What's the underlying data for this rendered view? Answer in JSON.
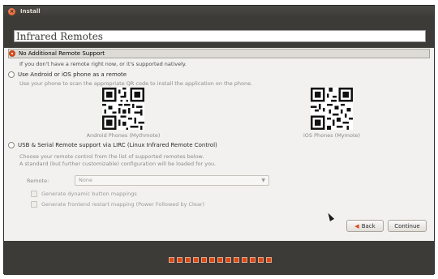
{
  "window": {
    "title": "Install"
  },
  "header": {
    "title": "Infrared Remotes"
  },
  "options": [
    {
      "label": "No Additional Remote Support",
      "description": "If you don't have a remote right now, or it's supported natively.",
      "selected": true
    },
    {
      "label": "Use Android or iOS phone as a remote",
      "description": "Use your phone to scan the appropriate QR code to install the application on the phone.",
      "selected": false
    },
    {
      "label": "USB & Serial Remote support via LIRC (Linux Infrared Remote Control)",
      "description_line1": "Choose your remote control from the list of supported remotes below.",
      "description_line2": "A standard (but further customizable) configuration will be loaded for you.",
      "selected": false
    }
  ],
  "qr": {
    "android_caption": "Android Phones (Mythmote)",
    "ios_caption": "iOS Phones (Mymote)"
  },
  "remote": {
    "label": "Remote:",
    "value": "None",
    "checkbox_dynamic": "Generate dynamic button mappings",
    "checkbox_restart": "Generate frontend restart mapping (Power Followed by Clear)"
  },
  "buttons": {
    "back": "Back",
    "continue": "Continue"
  },
  "progress": {
    "total": 13,
    "completed": 13
  },
  "colors": {
    "accent": "#dd4814",
    "titlebar": "#3c3b37"
  },
  "icons": {
    "close": "close-icon",
    "back_arrow": "back-arrow-icon",
    "radio": "radio-icon"
  }
}
